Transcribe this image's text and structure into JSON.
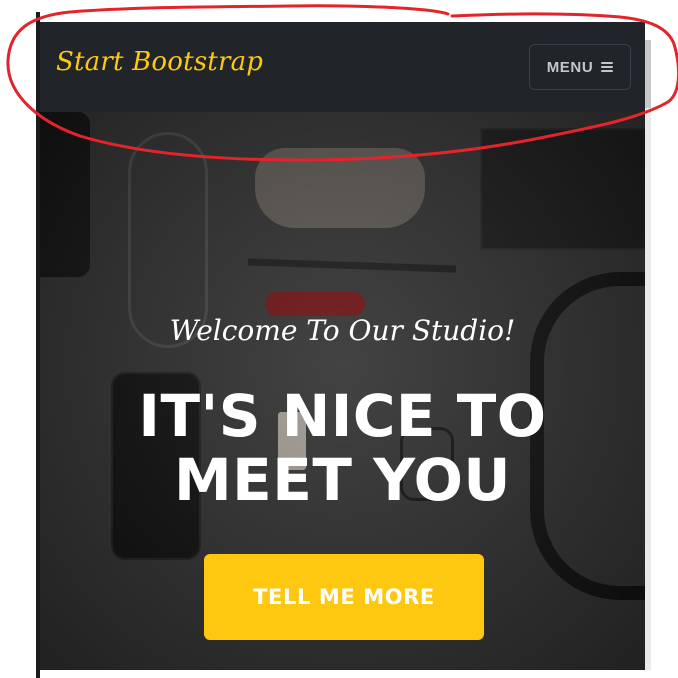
{
  "navbar": {
    "brand": "Start Bootstrap",
    "menu_label": "MENU",
    "menu_icon": "hamburger-icon"
  },
  "hero": {
    "subheading": "Welcome To Our Studio!",
    "heading_line1": "IT'S NICE TO",
    "heading_line2": "MEET YOU",
    "cta_label": "TELL ME MORE"
  },
  "colors": {
    "accent": "#fec810",
    "navbar_bg": "#212529",
    "annotation": "#e3242b"
  }
}
